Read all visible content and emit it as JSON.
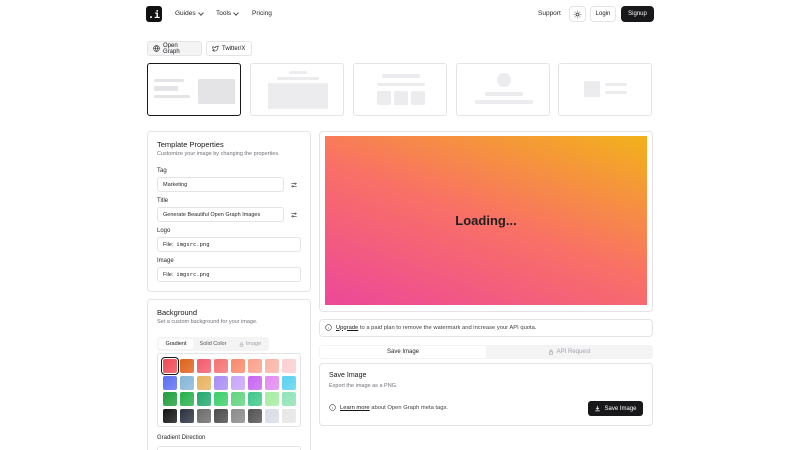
{
  "header": {
    "logo_text": ".i",
    "nav": [
      {
        "label": "Guides"
      },
      {
        "label": "Tools"
      },
      {
        "label": "Pricing"
      }
    ],
    "support_label": "Support",
    "login_label": "Login",
    "signup_label": "Signup"
  },
  "platform_tabs": [
    {
      "label": "Open Graph",
      "icon": "globe-icon",
      "active": true
    },
    {
      "label": "Twitter/X",
      "icon": "twitter-icon",
      "active": false
    }
  ],
  "template_properties": {
    "title": "Template Properties",
    "subtitle": "Customize your image by changing the properties.",
    "tag_label": "Tag",
    "tag_value": "Marketing",
    "title_label": "Title",
    "title_value": "Generate Beautiful Open Graph Images",
    "logo_label": "Logo",
    "logo_prefix": "File:",
    "logo_file": "imgsrc.png",
    "image_label": "Image",
    "image_prefix": "File:",
    "image_file": "imgsrc.png"
  },
  "background": {
    "title": "Background",
    "subtitle": "Set a custom background for your image.",
    "tabs": [
      {
        "label": "Gradient",
        "active": true
      },
      {
        "label": "Solid Color",
        "active": false
      },
      {
        "label": "Image",
        "active": false
      }
    ],
    "swatches": [
      [
        "#ee4b55",
        "#e0621b",
        "#f25b6b",
        "#f47272",
        "#f8896a",
        "#f9a08a",
        "#fab4a6",
        "#fbcfd0"
      ],
      [
        "#5b6ff0",
        "#86b6d8",
        "#e8b25f",
        "#a88cf5",
        "#c8a5f9",
        "#c765f2",
        "#e28bf0",
        "#5ad2f0"
      ],
      [
        "#1f9e3b",
        "#28b04a",
        "#22a86d",
        "#3ccf6a",
        "#61d47e",
        "#3fc789",
        "#a5eca0",
        "#8fe3b6"
      ],
      [
        "#141414",
        "#2a3140",
        "#6b6b6b",
        "#4a4a4a",
        "#8a8a8a",
        "#525252",
        "#d8dde6",
        "#e6e6e6"
      ]
    ],
    "direction_label": "Gradient Direction"
  },
  "preview": {
    "loading_text": "Loading...",
    "gradient_colors": [
      "#ec4899",
      "#f97066",
      "#f2b21a"
    ]
  },
  "upgrade_notice": {
    "link": "Upgrade",
    "text": "to a paid plan to remove the watermark and increase your API quota."
  },
  "action_tabs": [
    {
      "label": "Save Image",
      "active": true
    },
    {
      "label": "API Request",
      "active": false,
      "icon": "lock-icon"
    }
  ],
  "save_section": {
    "title": "Save Image",
    "subtitle": "Export the image as a PNG.",
    "learn_link": "Learn more",
    "learn_text": "about Open Graph meta tags.",
    "button_label": "Save Image"
  }
}
